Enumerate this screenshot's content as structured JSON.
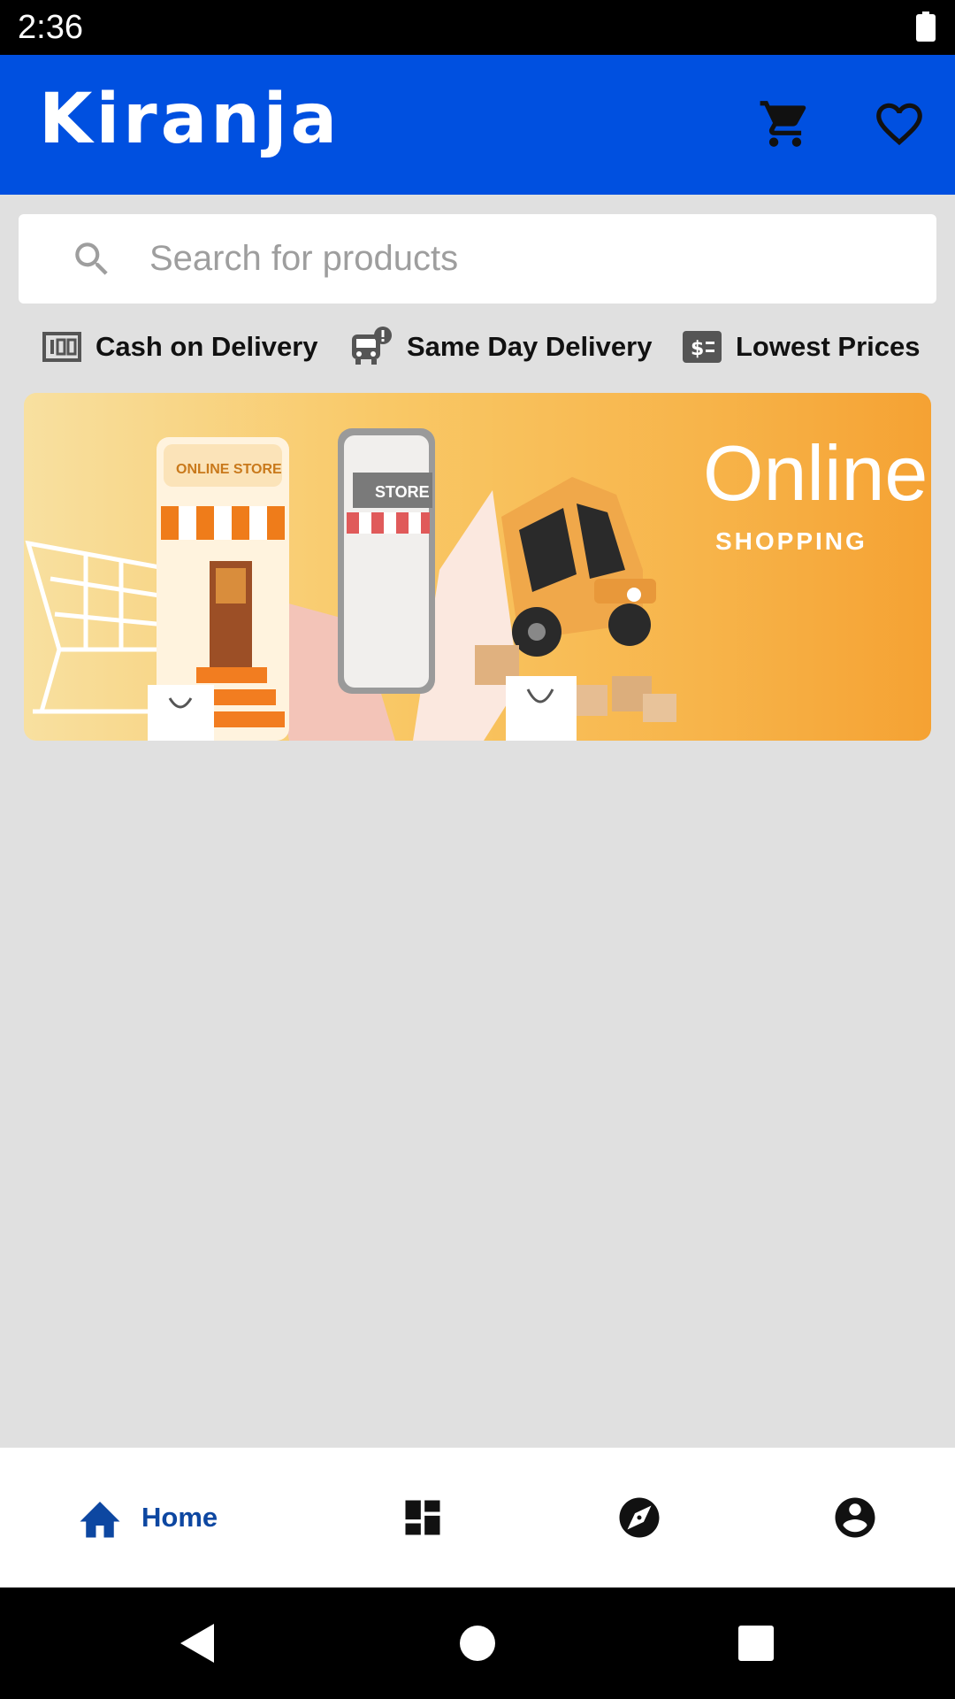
{
  "status_bar": {
    "time": "2:36"
  },
  "app_bar": {
    "title": "Kiranja",
    "icons": [
      "cart-icon",
      "heart-icon"
    ]
  },
  "search": {
    "placeholder": "Search for products",
    "value": ""
  },
  "features": [
    {
      "label": "Cash on Delivery",
      "icon": "cash-icon"
    },
    {
      "label": "Same Day Delivery",
      "icon": "bus-alert-icon"
    },
    {
      "label": "Lowest Prices",
      "icon": "price-tag-icon"
    }
  ],
  "banner": {
    "title": "Online.",
    "subtitle": "SHOPPING",
    "store_sign": "ONLINE STORE",
    "phone_sign": "STORE"
  },
  "bottom_nav": {
    "items": [
      {
        "label": "Home",
        "icon": "home-icon",
        "active": true
      },
      {
        "label": "",
        "icon": "dashboard-icon",
        "active": false
      },
      {
        "label": "",
        "icon": "explore-icon",
        "active": false
      },
      {
        "label": "",
        "icon": "account-icon",
        "active": false
      }
    ]
  },
  "colors": {
    "primary": "#0050e0",
    "active_nav": "#0d47a1",
    "background": "#e0e0e0"
  }
}
